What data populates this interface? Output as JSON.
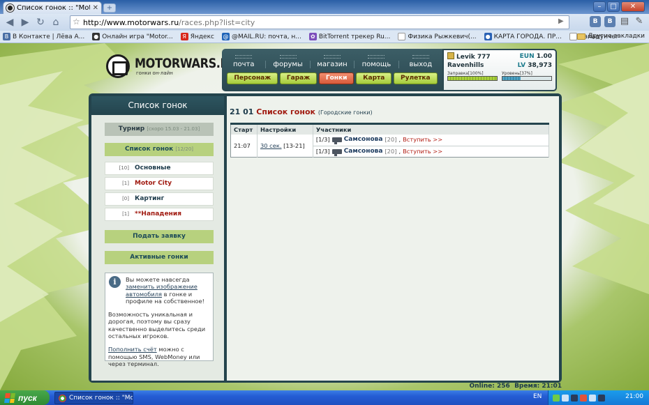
{
  "browser": {
    "tab_title": "Список гонок :: \"Motorwars\"",
    "url_host": "http://www.motorwars.ru",
    "url_path": "/races.php?list=city",
    "extension_labels": [
      "B",
      "B"
    ],
    "bookmarks": [
      {
        "label": "В Контакте | Лёва А...",
        "icon": "vk-icon",
        "color": "#4a6fa5",
        "glyph": "B"
      },
      {
        "label": "Онлайн игра \"Motor...",
        "icon": "motorwars-icon",
        "color": "#333333",
        "glyph": "●"
      },
      {
        "label": "Яндекс",
        "icon": "yandex-icon",
        "color": "#d8271b",
        "glyph": "Я"
      },
      {
        "label": "@MAIL.RU: почта, н...",
        "icon": "mailru-icon",
        "color": "#1e63b8",
        "glyph": "@"
      },
      {
        "label": "BitTorrent трекер Ru...",
        "icon": "torrent-icon",
        "color": "#7c4dbb",
        "glyph": "✿"
      },
      {
        "label": "Физика Рыжкевич(...",
        "icon": "page-icon",
        "color": "#ffffff",
        "glyph": ""
      },
      {
        "label": "КАРТА ГОРОДА. ПР...",
        "icon": "map-icon",
        "color": "#2a62b5",
        "glyph": "●"
      },
      {
        "label": "Нападунчег",
        "icon": "page-icon",
        "color": "#ffffff",
        "glyph": ""
      }
    ],
    "other_bookmarks": "Другие закладки"
  },
  "site": {
    "logo_name": "MOTORWARS.RU",
    "logo_sub": "гонки он-лайн",
    "topnav": [
      "почта",
      "форумы",
      "магазин",
      "помощь",
      "выход"
    ],
    "gamenav": [
      {
        "label": "Персонаж",
        "active": false
      },
      {
        "label": "Гараж",
        "active": false
      },
      {
        "label": "Гонки",
        "active": true
      },
      {
        "label": "Карта",
        "active": false
      },
      {
        "label": "Рулетка",
        "active": false
      }
    ],
    "profile": {
      "name": "Levik 777",
      "city": "Ravenhills",
      "eun_label": "EUN",
      "eun_value": "1.00",
      "lv_label": "LV",
      "lv_value": "38,973",
      "fuel_label": "Заправка[100%]",
      "fuel_value": 1.0,
      "level_label": "Уровень[37%]",
      "level_value": 0.37
    }
  },
  "sidebar": {
    "title": "Список гонок",
    "tournament_label": "Турнир",
    "tournament_note": "[скоро 15.03 - 21.03]",
    "list_label": "Список гонок",
    "list_count": "[12/20]",
    "items": [
      {
        "count": "[10]",
        "label": "Основные",
        "color": "blue"
      },
      {
        "count": "[1]",
        "label": "Motor City",
        "color": "red"
      },
      {
        "count": "[0]",
        "label": "Картинг",
        "color": "blue"
      },
      {
        "count": "[1]",
        "label": "**Нападения",
        "color": "red"
      }
    ],
    "submit_label": "Подать заявку",
    "active_label": "Активные гонки",
    "info": {
      "p1_a": "Вы можете навсегда ",
      "p1_link": "заменить изображение автомобиля",
      "p1_b": " в гонке и профиле на собственное!",
      "p2": "Возможность уникальная и дорогая, поэтому вы сразу качественно выделитесь среди остальных игроков.",
      "p3_link": "Пополнить счёт",
      "p3_b": " можно с помощью SMS, WebMoney или через терминал."
    }
  },
  "content": {
    "time": "21 01",
    "title": "Список гонок",
    "subtitle": "(Городские гонки)",
    "columns": [
      "Старт",
      "Настройки",
      "Участники"
    ],
    "rows": [
      {
        "start": "21:07",
        "settings_link": "30 сек.",
        "settings_range": "[13-21]",
        "participants": [
          {
            "slot": "[1/3]",
            "name": "Самсонова",
            "level": "[20]",
            "join": "Вступить >>"
          },
          {
            "slot": "[1/3]",
            "name": "Самсонова",
            "level": "[20]",
            "join": "Вступить >>"
          }
        ]
      }
    ]
  },
  "status": {
    "online_label": "Online:",
    "online_value": "256",
    "time_label": "Время:",
    "time_value": "21:01"
  },
  "taskbar": {
    "start_label": "пуск",
    "task_label": "Список гонок :: \"Mot...",
    "lang": "EN",
    "clock": "21:00"
  }
}
